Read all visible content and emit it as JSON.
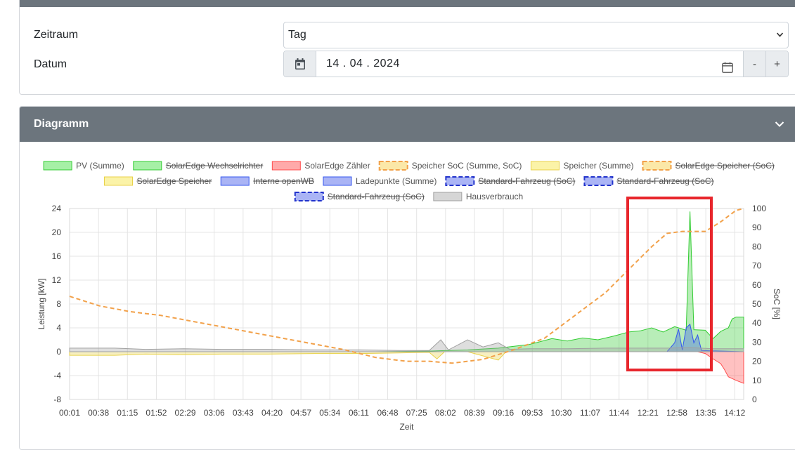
{
  "form": {
    "period_label": "Zeitraum",
    "period_value": "Tag",
    "date_label": "Datum",
    "date_value": "14 . 04 . 2024",
    "minus_label": "-",
    "plus_label": "+"
  },
  "chart_card": {
    "title": "Diagramm"
  },
  "colors": {
    "header_bg": "#6c757d",
    "pv": "#33cc33",
    "meter": "#ff4d4d",
    "soc": "#f2a14a",
    "storage": "#f5e56b",
    "charge": "#3355ee",
    "house": "#a0a0a0",
    "highlight": "#e8262c"
  },
  "legend": [
    {
      "label": "PV (Summe)",
      "type": "box",
      "fill": "#a6f0a6",
      "stroke": "#33cc33",
      "struck": false
    },
    {
      "label": "SolarEdge Wechselrichter",
      "type": "box",
      "fill": "#a6f0a6",
      "stroke": "#33cc33",
      "struck": true
    },
    {
      "label": "SolarEdge Zähler",
      "type": "box",
      "fill": "#ffaaaa",
      "stroke": "#ff4d4d",
      "struck": false
    },
    {
      "label": "Speicher SoC (Summe, SoC)",
      "type": "dash",
      "fill": "#fbe8a8",
      "stroke": "#f2a14a",
      "struck": false
    },
    {
      "label": "Speicher (Summe)",
      "type": "box",
      "fill": "#fbf3a8",
      "stroke": "#e8d24a",
      "struck": false
    },
    {
      "label": "SolarEdge Speicher (SoC)",
      "type": "dash",
      "fill": "#fbe8a8",
      "stroke": "#f2a14a",
      "struck": true
    },
    {
      "label": "SolarEdge Speicher",
      "type": "box",
      "fill": "#fbf3a8",
      "stroke": "#e8d24a",
      "struck": true
    },
    {
      "label": "Interne openWB",
      "type": "box",
      "fill": "#aab4f5",
      "stroke": "#3355ee",
      "struck": true
    },
    {
      "label": "Ladepunkte (Summe)",
      "type": "box",
      "fill": "#aab4f5",
      "stroke": "#3355ee",
      "struck": false
    },
    {
      "label": "Standard-Fahrzeug (SoC)",
      "type": "dash",
      "fill": "#aab4f5",
      "stroke": "#2233cc",
      "struck": true
    },
    {
      "label": "Standard-Fahrzeug (SoC)",
      "type": "dash",
      "fill": "#aab4f5",
      "stroke": "#2233cc",
      "struck": true
    },
    {
      "label": "Standard-Fahrzeug (SoC)",
      "type": "dash",
      "fill": "#aab4f5",
      "stroke": "#2233cc",
      "struck": true
    },
    {
      "label": "Hausverbrauch",
      "type": "box",
      "fill": "#d6d6d6",
      "stroke": "#a0a0a0",
      "struck": false
    }
  ],
  "chart_data": {
    "type": "area",
    "xlabel": "Zeit",
    "ylabel": "Leistung [kW]",
    "y2label": "SoC [%]",
    "ylim": [
      -8,
      24
    ],
    "y2lim": [
      0,
      100
    ],
    "yticks": [
      "24",
      "20",
      "16",
      "12",
      "8",
      "4",
      "0",
      "-4",
      "-8"
    ],
    "y2ticks": [
      "100",
      "90",
      "80",
      "70",
      "60",
      "50",
      "40",
      "30",
      "20",
      "10",
      "0"
    ],
    "xticks": [
      "00:01",
      "00:38",
      "01:15",
      "01:52",
      "02:29",
      "03:06",
      "03:43",
      "04:20",
      "04:57",
      "05:34",
      "06:11",
      "06:48",
      "07:25",
      "08:02",
      "08:39",
      "09:16",
      "09:53",
      "10:30",
      "11:07",
      "11:44",
      "12:21",
      "12:58",
      "13:35",
      "14:12"
    ],
    "grid": true,
    "legend_position": "top",
    "x_start_min": 1,
    "x_end_min": 880,
    "series": [
      {
        "name": "PV (Summe)",
        "axis": "y",
        "color": "#33cc33",
        "points": [
          [
            1,
            0
          ],
          [
            400,
            0
          ],
          [
            470,
            0.1
          ],
          [
            520,
            0.3
          ],
          [
            560,
            0.6
          ],
          [
            600,
            1.2
          ],
          [
            630,
            2.2
          ],
          [
            650,
            1.8
          ],
          [
            670,
            2.3
          ],
          [
            690,
            2.0
          ],
          [
            710,
            2.6
          ],
          [
            730,
            3.3
          ],
          [
            745,
            3.5
          ],
          [
            760,
            4.0
          ],
          [
            775,
            3.3
          ],
          [
            790,
            4.2
          ],
          [
            805,
            3.6
          ],
          [
            810,
            23.5
          ],
          [
            815,
            3.7
          ],
          [
            830,
            3.6
          ],
          [
            840,
            2.2
          ],
          [
            850,
            3.4
          ],
          [
            860,
            4.0
          ],
          [
            865,
            5.5
          ],
          [
            870,
            5.8
          ],
          [
            880,
            5.8
          ]
        ]
      },
      {
        "name": "SolarEdge Zähler",
        "axis": "y",
        "color": "#ff4d4d",
        "points": [
          [
            1,
            0
          ],
          [
            820,
            0
          ],
          [
            830,
            -0.3
          ],
          [
            840,
            -1.2
          ],
          [
            850,
            -2.0
          ],
          [
            855,
            -3.0
          ],
          [
            860,
            -4.2
          ],
          [
            870,
            -4.8
          ],
          [
            880,
            -5.3
          ]
        ]
      },
      {
        "name": "Speicher (Summe)",
        "axis": "y",
        "color": "#e8d24a",
        "points": [
          [
            1,
            -0.6
          ],
          [
            60,
            -0.6
          ],
          [
            100,
            -0.4
          ],
          [
            150,
            -0.5
          ],
          [
            200,
            -0.4
          ],
          [
            260,
            -0.4
          ],
          [
            320,
            -0.3
          ],
          [
            380,
            -0.3
          ],
          [
            430,
            -0.2
          ],
          [
            470,
            -0.1
          ],
          [
            480,
            -1.2
          ],
          [
            490,
            0
          ],
          [
            520,
            0
          ],
          [
            560,
            -1.4
          ],
          [
            570,
            0
          ],
          [
            600,
            0
          ],
          [
            630,
            0
          ],
          [
            650,
            0
          ],
          [
            880,
            0
          ]
        ]
      },
      {
        "name": "Ladepunkte (Summe)",
        "axis": "y",
        "color": "#3355ee",
        "points": [
          [
            1,
            0
          ],
          [
            780,
            0
          ],
          [
            790,
            1.5
          ],
          [
            795,
            3.8
          ],
          [
            800,
            0.3
          ],
          [
            805,
            4.0
          ],
          [
            810,
            4.6
          ],
          [
            815,
            1.5
          ],
          [
            820,
            2.8
          ],
          [
            825,
            0.2
          ],
          [
            880,
            0
          ]
        ]
      },
      {
        "name": "Hausverbrauch",
        "axis": "y",
        "color": "#a0a0a0",
        "points": [
          [
            1,
            0.6
          ],
          [
            60,
            0.6
          ],
          [
            100,
            0.4
          ],
          [
            150,
            0.5
          ],
          [
            200,
            0.4
          ],
          [
            260,
            0.4
          ],
          [
            320,
            0.3
          ],
          [
            380,
            0.3
          ],
          [
            430,
            0.2
          ],
          [
            470,
            0.2
          ],
          [
            485,
            2.0
          ],
          [
            495,
            0.3
          ],
          [
            520,
            2.0
          ],
          [
            540,
            0.8
          ],
          [
            560,
            1.5
          ],
          [
            575,
            0.4
          ],
          [
            600,
            0.5
          ],
          [
            650,
            0.5
          ],
          [
            700,
            0.6
          ],
          [
            750,
            0.6
          ],
          [
            780,
            0.6
          ],
          [
            810,
            0.7
          ],
          [
            840,
            0.5
          ],
          [
            880,
            0.5
          ]
        ]
      },
      {
        "name": "Speicher SoC (Summe, SoC)",
        "axis": "y2",
        "color": "#f2a14a",
        "dashed": true,
        "points": [
          [
            1,
            54
          ],
          [
            40,
            49
          ],
          [
            80,
            46
          ],
          [
            120,
            44
          ],
          [
            160,
            41
          ],
          [
            200,
            38
          ],
          [
            240,
            35
          ],
          [
            280,
            32
          ],
          [
            320,
            29
          ],
          [
            360,
            26
          ],
          [
            400,
            22
          ],
          [
            440,
            20
          ],
          [
            470,
            20
          ],
          [
            500,
            19
          ],
          [
            540,
            21
          ],
          [
            580,
            26
          ],
          [
            620,
            32
          ],
          [
            660,
            44
          ],
          [
            700,
            56
          ],
          [
            730,
            68
          ],
          [
            760,
            80
          ],
          [
            780,
            87
          ],
          [
            800,
            88
          ],
          [
            830,
            88
          ],
          [
            850,
            93
          ],
          [
            870,
            99
          ],
          [
            880,
            100
          ]
        ]
      }
    ]
  }
}
